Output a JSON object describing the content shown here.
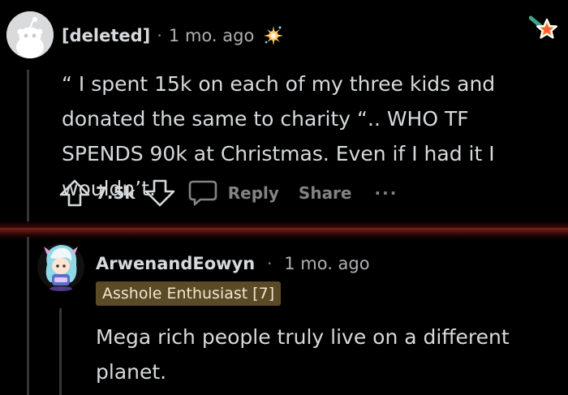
{
  "top_comment": {
    "author": "[deleted]",
    "separator": "·",
    "time": "1 mo. ago",
    "body": "“ I spent 15k on each of my three kids and donated the same to charity “.. WHO TF SPENDS 90k at Christmas. Even if I had it I wouldn’t.",
    "score": "7.5k",
    "reply_label": "Reply",
    "share_label": "Share",
    "more_label": "···"
  },
  "reply_comment": {
    "author": "ArwenandEowyn",
    "separator": "·",
    "time": "1 mo. ago",
    "flair": "Asshole Enthusiast [7]",
    "body": "Mega rich people truly live on a different planet."
  },
  "colors": {
    "background": "#000000",
    "text": "#d7dadc",
    "meta": "#818384",
    "flair_bg": "#5b4a26",
    "divider_glow": "#8f2a1f"
  },
  "icons": [
    "reddit-default-avatar-icon",
    "sparkle-award-icon",
    "star-badge-icon",
    "upvote-icon",
    "downvote-icon",
    "comment-bubble-icon",
    "more-options-icon",
    "user-avatar-icon"
  ]
}
